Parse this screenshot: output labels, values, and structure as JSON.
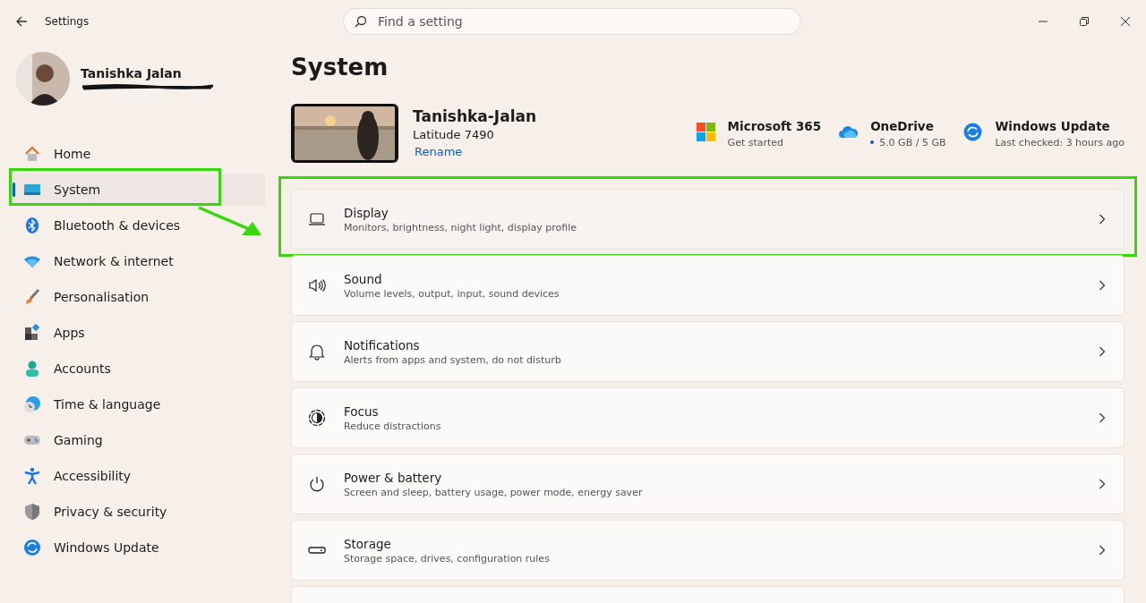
{
  "window": {
    "title": "Settings"
  },
  "search": {
    "placeholder": "Find a setting"
  },
  "user": {
    "name": "Tanishka Jalan",
    "email_redacted": true
  },
  "nav": [
    {
      "label": "Home",
      "selected": false,
      "annotated": false
    },
    {
      "label": "System",
      "selected": true,
      "annotated": true
    },
    {
      "label": "Bluetooth & devices",
      "selected": false,
      "annotated": false
    },
    {
      "label": "Network & internet",
      "selected": false,
      "annotated": false
    },
    {
      "label": "Personalisation",
      "selected": false,
      "annotated": false
    },
    {
      "label": "Apps",
      "selected": false,
      "annotated": false
    },
    {
      "label": "Accounts",
      "selected": false,
      "annotated": false
    },
    {
      "label": "Time & language",
      "selected": false,
      "annotated": false
    },
    {
      "label": "Gaming",
      "selected": false,
      "annotated": false
    },
    {
      "label": "Accessibility",
      "selected": false,
      "annotated": false
    },
    {
      "label": "Privacy & security",
      "selected": false,
      "annotated": false
    },
    {
      "label": "Windows Update",
      "selected": false,
      "annotated": false
    }
  ],
  "page_title": "System",
  "device": {
    "name": "Tanishka-Jalan",
    "model": "Latitude 7490",
    "rename": "Rename"
  },
  "services": [
    {
      "title": "Microsoft 365",
      "detail": "Get started",
      "dot": false
    },
    {
      "title": "OneDrive",
      "detail": "5.0 GB / 5 GB",
      "dot": true
    },
    {
      "title": "Windows Update",
      "detail": "Last checked: 3 hours ago",
      "dot": false
    }
  ],
  "cards": [
    {
      "title": "Display",
      "subtitle": "Monitors, brightness, night light, display profile",
      "hovered": true,
      "annotated": true
    },
    {
      "title": "Sound",
      "subtitle": "Volume levels, output, input, sound devices",
      "hovered": false,
      "annotated": false
    },
    {
      "title": "Notifications",
      "subtitle": "Alerts from apps and system, do not disturb",
      "hovered": false,
      "annotated": false
    },
    {
      "title": "Focus",
      "subtitle": "Reduce distractions",
      "hovered": false,
      "annotated": false
    },
    {
      "title": "Power & battery",
      "subtitle": "Screen and sleep, battery usage, power mode, energy saver",
      "hovered": false,
      "annotated": false
    },
    {
      "title": "Storage",
      "subtitle": "Storage space, drives, configuration rules",
      "hovered": false,
      "annotated": false
    }
  ],
  "annotation_arrow": true
}
